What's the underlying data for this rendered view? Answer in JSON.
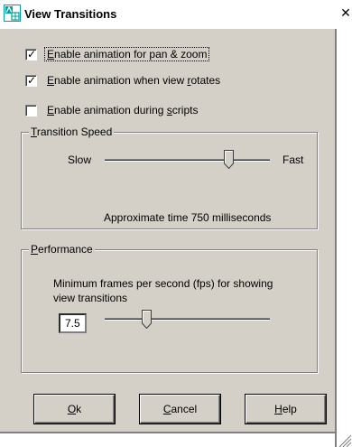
{
  "window": {
    "title": "View Transitions",
    "close_glyph": "✕",
    "icon": "autocad-view-icon"
  },
  "options": [
    {
      "label_key": "E",
      "label_rest": "nable animation for pan & zoom",
      "checked": true
    },
    {
      "label_key": "E",
      "label_rest": "nable animation when view ",
      "label_key2": "r",
      "label_rest2": "otates",
      "checked": true
    },
    {
      "label_key": "E",
      "label_rest": "nable animation during ",
      "label_key2": "s",
      "label_rest2": "cripts",
      "checked": false
    }
  ],
  "transition_speed": {
    "legend_key": "T",
    "legend_rest": "ransition Speed",
    "slow_label": "Slow",
    "fast_label": "Fast",
    "level": 0.75,
    "approx_text": "Approximate time 750 milliseconds"
  },
  "performance": {
    "legend_key": "P",
    "legend_rest": "erformance",
    "description": "Minimum frames per second (fps) for showing view transitions",
    "fps_value": "7.5",
    "level": 0.25
  },
  "buttons": {
    "ok_key": "O",
    "ok_rest": "k",
    "cancel_key": "C",
    "cancel_rest": "ancel",
    "help_key": "H",
    "help_rest": "elp"
  }
}
